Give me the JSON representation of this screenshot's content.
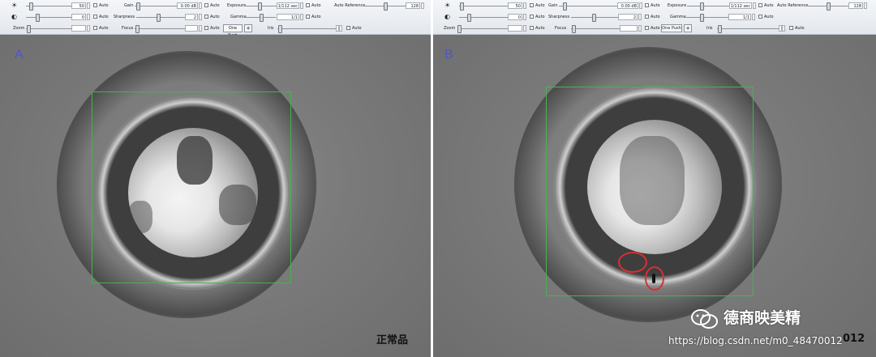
{
  "toolbar_a": {
    "row1": {
      "brightness_value": "50",
      "auto": "Auto",
      "gain_label": "Gain",
      "gain_value": "0.00 dB",
      "exposure_label": "Exposure",
      "exposure_value": "1/112 sec",
      "auto_reference_label": "Auto Reference",
      "auto_reference_value": "128"
    },
    "row2": {
      "contrast_value": "0",
      "auto": "Auto",
      "sharpness_label": "Sharpness",
      "sharpness_value": "2",
      "gamma_label": "Gamma",
      "gamma_value": "1/1"
    },
    "row3": {
      "zoom_label": "Zoom",
      "auto": "Auto",
      "focus_label": "Focus",
      "one_push_label": "One Push",
      "iris_label": "Iris"
    }
  },
  "toolbar_b": {
    "row1": {
      "brightness_value": "50",
      "auto": "Auto",
      "gain_label": "Gain",
      "gain_value": "0.00 dB",
      "exposure_label": "Exposure",
      "exposure_value": "1/112 sec",
      "auto_reference_label": "Auto Reference",
      "auto_reference_value": "128"
    },
    "row2": {
      "contrast_value": "0",
      "auto": "Auto",
      "sharpness_label": "Sharpness",
      "sharpness_value": "2",
      "gamma_label": "Gamma",
      "gamma_value": "1/1"
    },
    "row3": {
      "zoom_label": "Zoom",
      "auto": "Auto",
      "focus_label": "Focus",
      "one_push_label": "One Push",
      "iris_label": "Iris"
    }
  },
  "panel_a": {
    "label": "A",
    "caption": "正常品"
  },
  "panel_b": {
    "label": "B"
  },
  "watermark": {
    "brand": "德商映美精",
    "url": "https://blog.csdn.net/m0_48470012",
    "url_tail": "012"
  },
  "colors": {
    "roi": "#46b44a",
    "defect_marker": "#d93030",
    "panel_label": "#4a56d8"
  },
  "icons": {
    "brightness": "sun-icon",
    "contrast": "contrast-icon",
    "wechat": "wechat-icon"
  }
}
